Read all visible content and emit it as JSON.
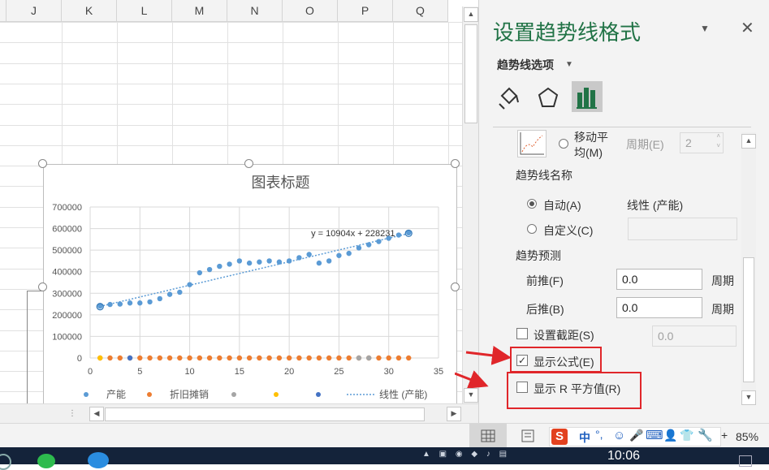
{
  "sheet": {
    "columns": [
      "J",
      "K",
      "L",
      "M",
      "N",
      "O",
      "P",
      "Q"
    ]
  },
  "chart_data": {
    "type": "scatter",
    "title": "图表标题",
    "ylim": [
      0,
      700000
    ],
    "xlim": [
      0,
      35
    ],
    "yticks": [
      "0",
      "100000",
      "200000",
      "300000",
      "400000",
      "500000",
      "600000",
      "700000"
    ],
    "xticks": [
      "0",
      "5",
      "10",
      "15",
      "20",
      "25",
      "30",
      "35"
    ],
    "grid": true,
    "legend_position": "bottom",
    "series": [
      {
        "name": "产能",
        "color": "#5b9bd5",
        "x": [
          1,
          2,
          3,
          4,
          5,
          6,
          7,
          8,
          9,
          10,
          11,
          12,
          13,
          14,
          15,
          16,
          17,
          18,
          19,
          20,
          21,
          22,
          23,
          24,
          25,
          26,
          27,
          28,
          29,
          30,
          31,
          32
        ],
        "y": [
          240000,
          248000,
          250000,
          255000,
          255000,
          260000,
          275000,
          295000,
          305000,
          340000,
          395000,
          410000,
          425000,
          435000,
          450000,
          440000,
          445000,
          450000,
          445000,
          450000,
          465000,
          480000,
          440000,
          450000,
          475000,
          485000,
          510000,
          525000,
          540000,
          555000,
          570000,
          580000
        ]
      },
      {
        "name": "折旧摊销",
        "color": "#ed7d31",
        "x": [
          1,
          2,
          3,
          4,
          5,
          6,
          7,
          8,
          9,
          10,
          11,
          12,
          13,
          14,
          15,
          16,
          17,
          18,
          19,
          20,
          21,
          22,
          23,
          24,
          25,
          26,
          27,
          28,
          29,
          30,
          31,
          32
        ],
        "y": [
          0,
          0,
          0,
          0,
          0,
          0,
          0,
          0,
          0,
          0,
          0,
          0,
          0,
          0,
          0,
          0,
          0,
          0,
          0,
          0,
          0,
          0,
          0,
          0,
          0,
          0,
          0,
          0,
          0,
          0,
          0,
          0
        ]
      },
      {
        "name": "",
        "color": "#a5a5a5",
        "x": [
          27,
          28
        ],
        "y": [
          0,
          0
        ]
      },
      {
        "name": "",
        "color": "#ffc000",
        "x": [
          1
        ],
        "y": [
          0
        ]
      },
      {
        "name": "",
        "color": "#4472c4",
        "x": [
          4
        ],
        "y": [
          0
        ]
      }
    ],
    "trendline": {
      "name": "线性 (产能)",
      "slope": 10904,
      "intercept": 228231,
      "label": "y = 10904x + 228231",
      "color": "#5b9bd5"
    }
  },
  "pane": {
    "title": "设置趋势线格式",
    "options_label": "趋势线选项",
    "icons": [
      "fill-icon",
      "pentagon-icon",
      "bar-chart-icon"
    ],
    "moving_avg_label_line1": "移动平",
    "moving_avg_label_line2": "均(M)",
    "period_label": "周期(E)",
    "period_value": "2",
    "name_section": "趋势线名称",
    "auto_label": "自动(A)",
    "auto_value": "线性 (产能)",
    "custom_label": "自定义(C)",
    "forecast_section": "趋势预测",
    "forward_label": "前推(F)",
    "forward_value": "0.0",
    "forward_unit": "周期",
    "backward_label": "后推(B)",
    "backward_value": "0.0",
    "backward_unit": "周期",
    "intercept_label": "设置截距(S)",
    "intercept_value": "0.0",
    "show_equation_label": "显示公式(E)",
    "show_equation_checked": true,
    "show_r2_label": "显示 R 平方值(R)",
    "show_r2_checked": false
  },
  "statusbar": {
    "zoom": "85%",
    "ime_text": "中"
  },
  "taskbar": {
    "time": "10:06"
  }
}
